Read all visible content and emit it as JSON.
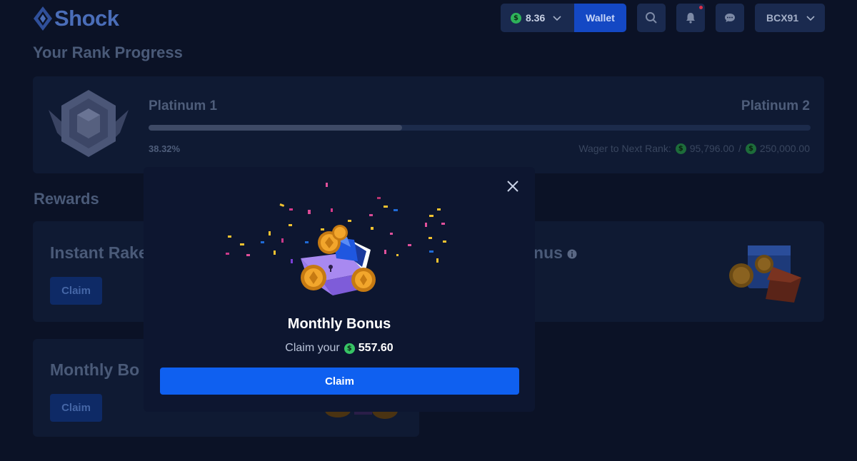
{
  "header": {
    "logo_text": "Shock",
    "balance": {
      "currency_symbol": "$",
      "amount": "8.36"
    },
    "wallet_label": "Wallet",
    "username": "BCX91",
    "notifications_unread": true
  },
  "rank_progress": {
    "title": "Your Rank Progress",
    "current_rank": "Platinum 1",
    "next_rank": "Platinum 2",
    "percent_label": "38.32%",
    "progress_fraction": 0.3832,
    "wager_label": "Wager to Next Rank:",
    "wager_current": "95,796.00",
    "wager_separator": "/",
    "wager_target": "250,000.00"
  },
  "rewards": {
    "title": "Rewards",
    "cards": [
      {
        "title": "Instant Rake",
        "claim_label": "Claim"
      },
      {
        "title": "onus"
      },
      {
        "title": "Monthly Bo",
        "claim_label": "Claim"
      }
    ]
  },
  "modal": {
    "title": "Monthly Bonus",
    "subtitle_prefix": "Claim your",
    "currency_symbol": "$",
    "amount": "557.60",
    "claim_label": "Claim"
  },
  "colors": {
    "background": "#0b1226",
    "card": "#0f1a33",
    "accent": "#0f60f0",
    "coin_green": "#37c465"
  }
}
